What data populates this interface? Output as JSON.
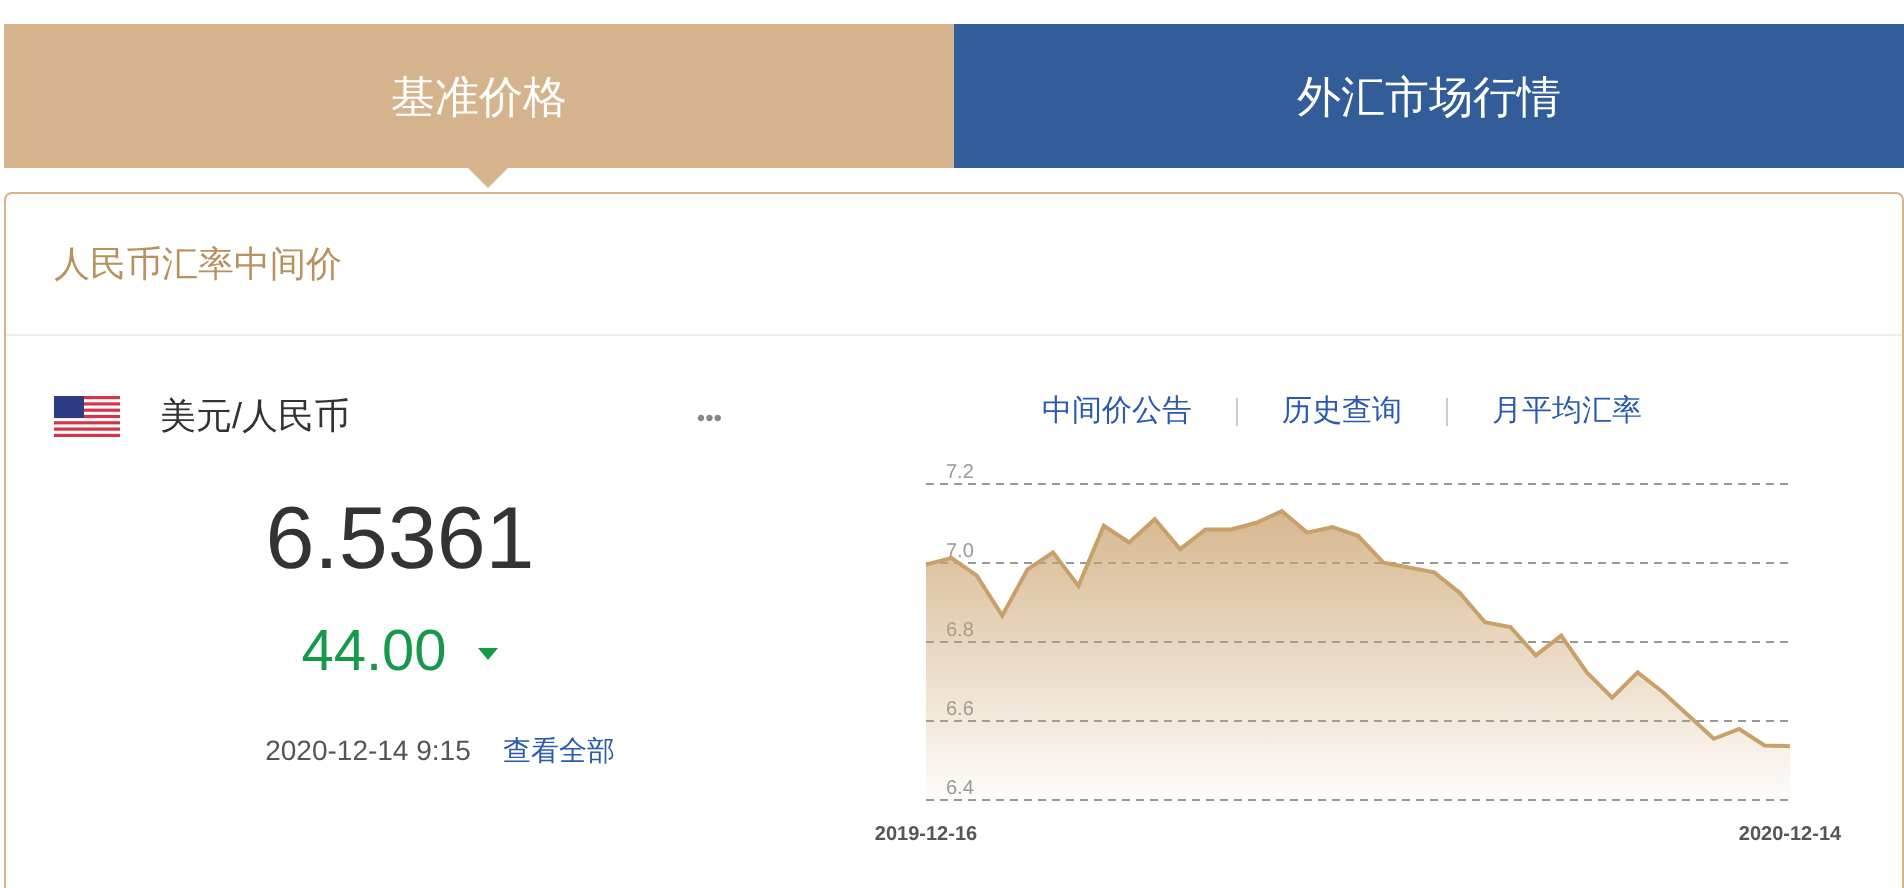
{
  "tabs": [
    {
      "label": "基准价格",
      "selected": true
    },
    {
      "label": "外汇市场行情",
      "selected": false
    }
  ],
  "card": {
    "title": "人民币汇率中间价"
  },
  "rate": {
    "pair": "美元/人民币",
    "more": "•••",
    "value": "6.5361",
    "change": "44.00",
    "falling": true,
    "time": "2020-12-14 9:15",
    "view_all": "查看全部"
  },
  "links": [
    "中间价公告",
    "历史查询",
    "月平均汇率"
  ],
  "chart_data": {
    "type": "area",
    "categories": [
      "2019-12-16",
      null,
      null,
      null,
      null,
      null,
      null,
      null,
      null,
      null,
      null,
      null,
      null,
      null,
      null,
      null,
      null,
      null,
      null,
      null,
      null,
      null,
      null,
      null,
      null,
      null,
      null,
      null,
      null,
      null,
      null,
      null,
      null,
      null,
      "2020-12-14"
    ],
    "series": [
      {
        "color": "#c9a06a",
        "values": [
          6.996,
          7.013,
          6.968,
          6.867,
          6.984,
          7.027,
          6.942,
          7.094,
          7.052,
          7.111,
          7.035,
          7.085,
          7.085,
          7.102,
          7.131,
          7.077,
          7.091,
          7.069,
          7.001,
          6.989,
          6.976,
          6.925,
          6.85,
          6.838,
          6.766,
          6.816,
          6.723,
          6.659,
          6.723,
          6.673,
          6.614,
          6.555,
          6.58,
          6.538,
          6.536
        ]
      }
    ],
    "ylim": [
      6.4,
      7.2
    ],
    "grid": true,
    "yticks": [
      {
        "value": 6.4,
        "label": "6.4"
      },
      {
        "value": 6.6,
        "label": "6.6"
      },
      {
        "value": 6.8,
        "label": "6.8"
      },
      {
        "value": 7.0,
        "label": "7.0"
      },
      {
        "value": 7.2,
        "label": "7.2"
      }
    ]
  }
}
